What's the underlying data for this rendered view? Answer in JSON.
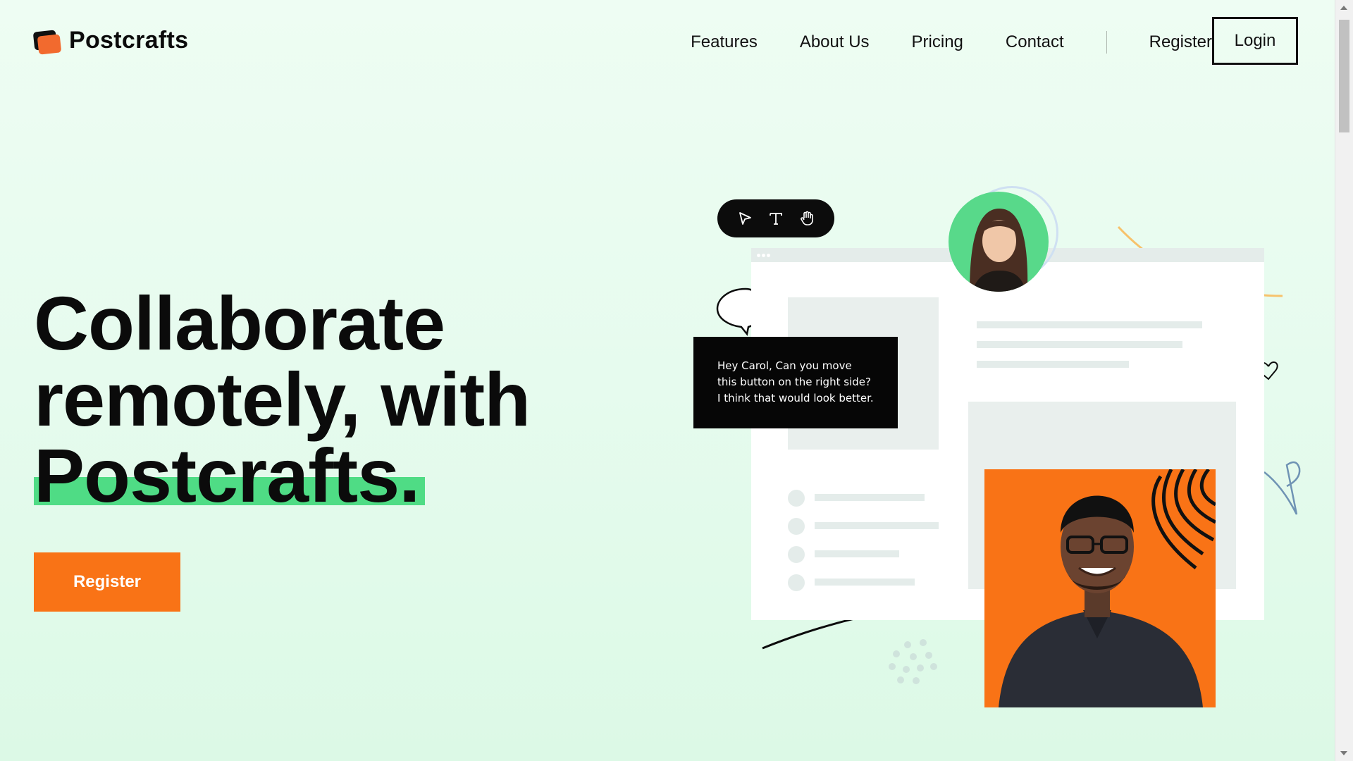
{
  "brand": {
    "name": "Postcrafts"
  },
  "nav": {
    "items": [
      "Features",
      "About Us",
      "Pricing",
      "Contact"
    ],
    "register_label": "Register",
    "login_label": "Login"
  },
  "hero": {
    "line1": "Collaborate",
    "line2": "remotely, with",
    "line3": "Postcrafts.",
    "cta_label": "Register"
  },
  "illustration": {
    "tools": [
      "pointer-icon",
      "text-icon",
      "hand-icon"
    ],
    "comment": "Hey Carol, Can you move this button on the right side? I think that would look better."
  },
  "colors": {
    "accent_orange": "#f97316",
    "accent_green": "#4fdc85",
    "logo_orange": "#f26a2e",
    "background": "#e6fbee"
  }
}
